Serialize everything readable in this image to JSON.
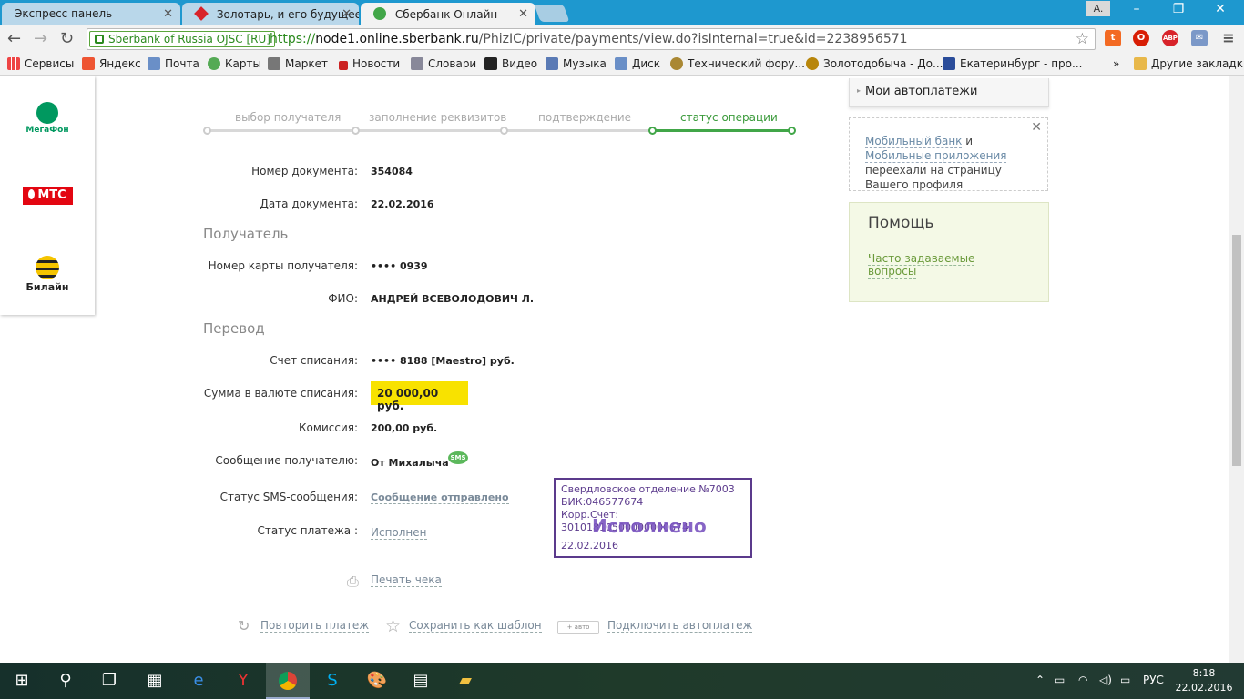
{
  "browser": {
    "tabs": [
      {
        "label": "Экспресс панель"
      },
      {
        "label": "Золотарь, и его будущее"
      },
      {
        "label": "Сбербанк Онлайн"
      }
    ],
    "user_badge": "A.",
    "ev_label": "Sberbank of Russia OJSC [RU]",
    "url": {
      "scheme": "https://",
      "host": "node1.online.sberbank.ru",
      "path": "/PhizIC/private/payments/view.do?isInternal=true&id=2238956571"
    },
    "bookmarks": [
      {
        "label": "Сервисы"
      },
      {
        "label": "Яндекс"
      },
      {
        "label": "Почта"
      },
      {
        "label": "Карты"
      },
      {
        "label": "Маркет"
      },
      {
        "label": "Новости"
      },
      {
        "label": "Словари"
      },
      {
        "label": "Видео"
      },
      {
        "label": "Музыка"
      },
      {
        "label": "Диск"
      },
      {
        "label": "Технический фору..."
      },
      {
        "label": "Золотодобыча - До..."
      },
      {
        "label": "Екатеринбург - про..."
      }
    ],
    "bookmarks_more": "»",
    "other_bookmarks": "Другие закладки"
  },
  "operators": [
    {
      "label": "МегаФон",
      "color": "#00985f"
    },
    {
      "label": "МТС",
      "color": "#e30611"
    },
    {
      "label": "Билайн",
      "color": "#f5c400"
    }
  ],
  "stepper": {
    "steps": [
      {
        "label": "выбор получателя"
      },
      {
        "label": "заполнение реквизитов"
      },
      {
        "label": "подтверждение"
      },
      {
        "label": "статус операции"
      }
    ]
  },
  "document": {
    "number_label": "Номер документа:",
    "number": "354084",
    "date_label": "Дата документа:",
    "date": "22.02.2016"
  },
  "recipient": {
    "section": "Получатель",
    "card_label": "Номер карты получателя:",
    "card": "•••• 0939",
    "name_label": "ФИО:",
    "name": "АНДРЕЙ ВСЕВОЛОДОВИЧ Л."
  },
  "transfer": {
    "section": "Перевод",
    "account_label": "Счет списания:",
    "account": "•••• 8188  [Maestro]  руб.",
    "amount_label": "Сумма в валюте списания:",
    "amount": "20 000,00  руб.",
    "fee_label": "Комиссия:",
    "fee": "200,00 руб.",
    "message_label": "Сообщение получателю:",
    "message": "От Михалыча",
    "sms_badge": "SMS",
    "sms_status_label": "Статус SMS-сообщения:",
    "sms_status": "Сообщение отправлено",
    "status_label": "Статус платежа :",
    "status": "Исполнен"
  },
  "stamp": {
    "line1": "Свердловское отделение №7003",
    "line2": "БИК:046577674",
    "line3": "Корр.Счет: 30101810500000000674",
    "big": "Исполнено",
    "date": "22.02.2016"
  },
  "actions": {
    "print": "Печать чека",
    "repeat": "Повторить платеж",
    "save_template": "Сохранить как шаблон",
    "auto_badge": "авто",
    "autopay": "Подключить автоплатеж"
  },
  "sidebar": {
    "my_autopay": "Мои автоплатежи",
    "notice_link1": "Мобильный банк",
    "notice_and": " и ",
    "notice_link2": "Мобильные приложения",
    "notice_text": " переехали на страницу Вашего профиля",
    "help_title": "Помощь",
    "help_link": "Часто задаваемые вопросы"
  },
  "taskbar": {
    "lang": "РУС",
    "time": "8:18",
    "date": "22.02.2016"
  },
  "colors": {
    "sber_green": "#41a648",
    "highlight_yellow": "#f8e200",
    "stamp_purple": "#5b3a8c"
  }
}
